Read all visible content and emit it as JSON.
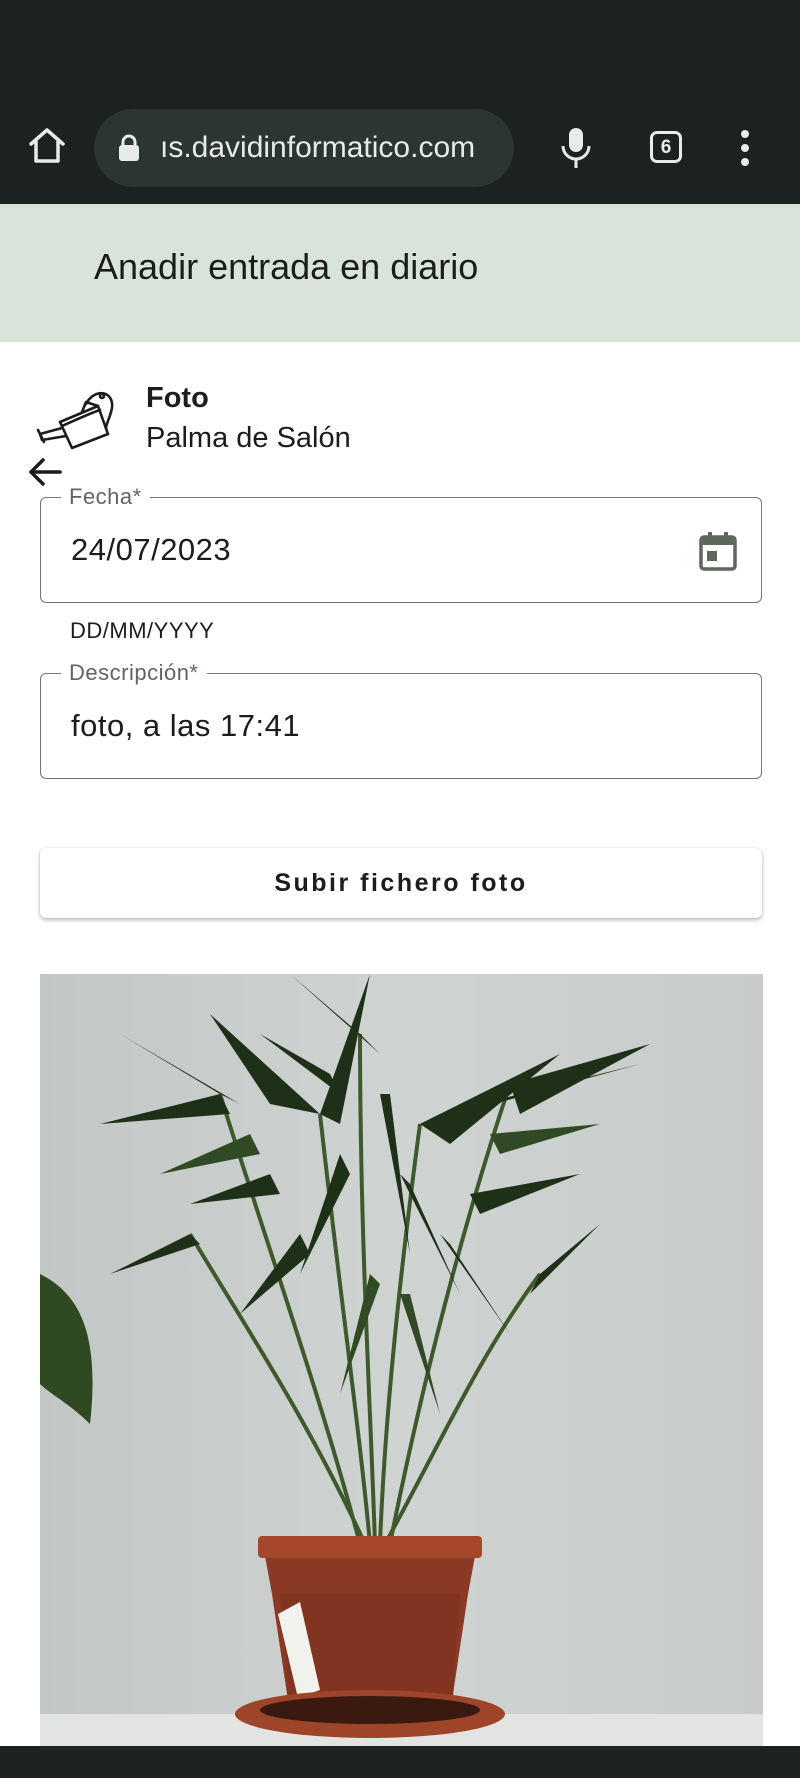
{
  "browser": {
    "url": "ıs.davidinformatico.com",
    "tab_count": "6",
    "icons": {
      "home": "home-icon",
      "lock": "lock-icon",
      "mic": "microphone-icon",
      "menu": "more-vert-icon"
    }
  },
  "app_bar": {
    "title": "Anadir entrada en diario",
    "background": "#d8e4d9",
    "back_icon": "arrow-back-icon"
  },
  "entry": {
    "icon": "watering-can-icon",
    "type": "Foto",
    "plant": "Palma de Salón"
  },
  "form": {
    "date": {
      "label": "Fecha*",
      "value": "24/07/2023",
      "helper": "DD/MM/YYYY",
      "icon": "calendar-icon"
    },
    "description": {
      "label": "Descripción*",
      "value": "foto, a las 17:41"
    },
    "upload_label": "Subir fichero foto"
  },
  "photo": {
    "subject": "plant-photo"
  },
  "colors": {
    "browser_bg": "#1c2121",
    "url_pill": "#2b3534",
    "app_bar": "#d8e4d9",
    "outline": "#73796f"
  }
}
